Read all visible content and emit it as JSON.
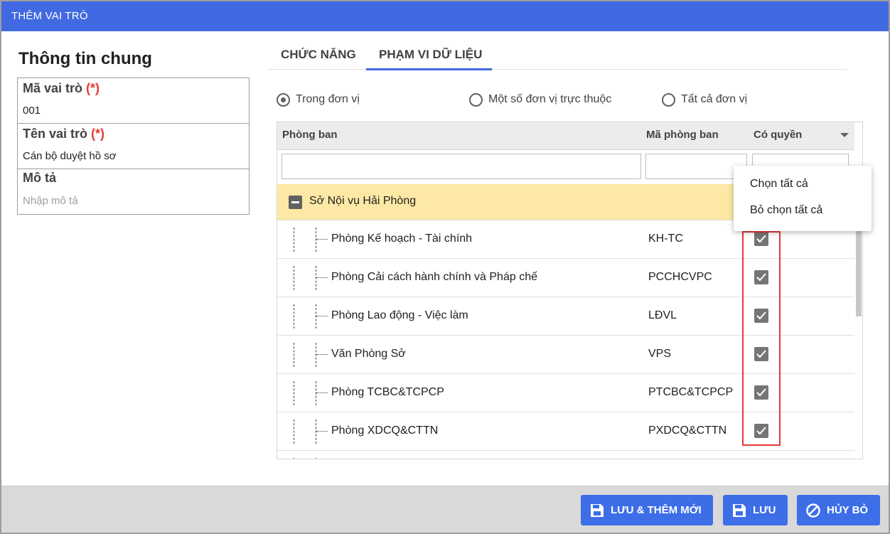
{
  "window": {
    "title": "THÊM VAI TRÒ"
  },
  "general": {
    "section_title": "Thông tin chung",
    "role_code": {
      "label": "Mã vai trò",
      "required_mark": "(*)",
      "value": "001"
    },
    "role_name": {
      "label": "Tên vai trò",
      "required_mark": "(*)",
      "value": "Cán bộ duyệt hồ sơ"
    },
    "description": {
      "label": "Mô tả",
      "placeholder": "Nhập mô tả"
    }
  },
  "tabs": [
    {
      "label": "CHỨC NĂNG",
      "active": false
    },
    {
      "label": "PHẠM VI DỮ LIỆU",
      "active": true
    }
  ],
  "scope": {
    "options": [
      {
        "label": "Trong đơn vị",
        "checked": true
      },
      {
        "label": "Một số đơn vị trực thuộc",
        "checked": false
      },
      {
        "label": "Tất cả đơn vị",
        "checked": false
      }
    ]
  },
  "grid": {
    "columns": {
      "department": "Phòng ban",
      "code": "Mã phòng ban",
      "permission": "Có quyền"
    },
    "group": {
      "label": "Sở Nội vụ Hải Phòng"
    },
    "rows": [
      {
        "name": "Phòng Kế hoạch - Tài chính",
        "code": "KH-TC",
        "checked": true
      },
      {
        "name": "Phòng Cải cách hành chính và Pháp chế",
        "code": "PCCHCVPC",
        "checked": true
      },
      {
        "name": "Phòng Lao động - Việc làm",
        "code": "LĐVL",
        "checked": true
      },
      {
        "name": "Văn Phòng Sở",
        "code": "VPS",
        "checked": true
      },
      {
        "name": "Phòng TCBC&TCPCP",
        "code": "PTCBC&TCPCP",
        "checked": true
      },
      {
        "name": "Phòng XDCQ&CTTN",
        "code": "PXDCQ&CTTN",
        "checked": true
      }
    ]
  },
  "menu": {
    "select_all": "Chọn tất cả",
    "deselect_all": "Bỏ chọn tất cả"
  },
  "footer": {
    "save_and_new": "LƯU & THÊM MỚI",
    "save": "LƯU",
    "cancel": "HỦY BỎ"
  },
  "colors": {
    "accent": "#4169e1",
    "button": "#3d6ee8",
    "highlight_row": "#fde9a5",
    "required": "#e53935"
  }
}
